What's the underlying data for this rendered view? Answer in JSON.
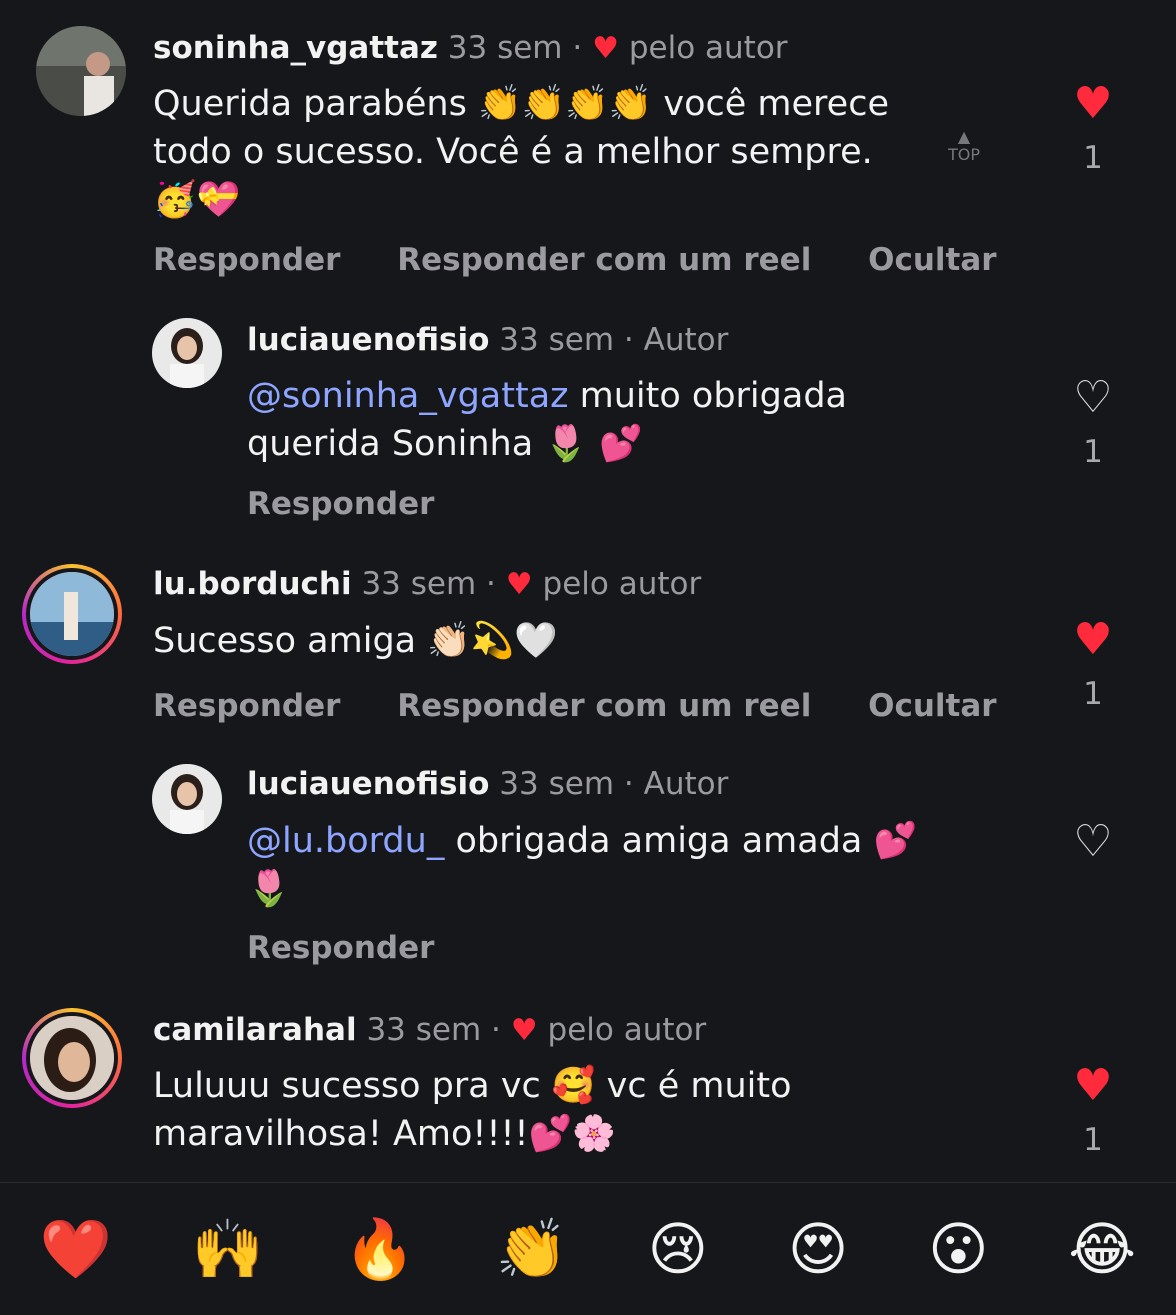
{
  "comments": [
    {
      "username": "soninha_vgattaz",
      "time": "33 sem",
      "liked_by_author": "pelo autor",
      "lines": [
        "Querida parabéns 👏👏👏👏 você merece",
        "todo o sucesso. Você é a melhor sempre.",
        "🥳💝"
      ],
      "top_badge": "TOP",
      "actions": [
        "Responder",
        "Responder com um reel",
        "Ocultar"
      ],
      "likes": "1",
      "liked": true,
      "reply": {
        "username": "luciauenofisio",
        "time": "33 sem",
        "tag": "Autor",
        "mention": "@soninha_vgattaz",
        "line1_rest": " muito obrigada",
        "line2": "querida Soninha 🌷 💕",
        "action": "Responder",
        "likes": "1",
        "liked": false
      }
    },
    {
      "username": "lu.borduchi",
      "time": "33 sem",
      "liked_by_author": "pelo autor",
      "lines": [
        "Sucesso amiga 👏🏻💫🤍"
      ],
      "actions": [
        "Responder",
        "Responder com um reel",
        "Ocultar"
      ],
      "likes": "1",
      "liked": true,
      "reply": {
        "username": "luciauenofisio",
        "time": "33 sem",
        "tag": "Autor",
        "mention": "@lu.bordu_",
        "line1_rest": " obrigada amiga amada 💕",
        "line2": "🌷",
        "action": "Responder",
        "likes": "",
        "liked": false
      }
    },
    {
      "username": "camilarahal",
      "time": "33 sem",
      "liked_by_author": "pelo autor",
      "lines": [
        "Luluuu sucesso pra vc 🥰 vc é muito",
        "maravilhosa! Amo!!!!💕🌸"
      ],
      "likes": "1",
      "liked": true
    }
  ],
  "reaction_bar": [
    "❤️",
    "🙌",
    "🔥",
    "👏",
    "😢",
    "😍",
    "😮",
    "😂"
  ],
  "colors": {
    "background": "#16171b",
    "heart": "#ff2b3d",
    "mention": "#8ea6ff",
    "meta": "#9a9aa0"
  }
}
